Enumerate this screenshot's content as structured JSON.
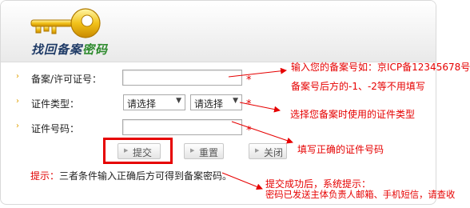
{
  "header": {
    "title_part1": "找回备案",
    "title_part2": "密码"
  },
  "form": {
    "fields": [
      {
        "label": "备案/许可证号：",
        "value": "",
        "required_mark": "*"
      },
      {
        "label": "证件类型：",
        "select1": "请选择",
        "select2": "请选择",
        "required_mark": "*"
      },
      {
        "label": "证件号码：",
        "value": "",
        "required_mark": "*"
      }
    ],
    "buttons": {
      "submit": "提交",
      "reset": "重置",
      "close": "关闭"
    },
    "tip_prefix": "提示：",
    "tip_text": "三者条件输入正确后方可得到备案密码。"
  },
  "annotations": {
    "a1": "输入您的备案号如：京ICP备12345678号",
    "a2": "备案号后方的-1、-2等不用填写",
    "a3": "选择您备案时使用的证件类型",
    "a4": "填写正确的证件号码",
    "a5": "提交成功后，系统提示：",
    "a6": "密码已发送主体负责人邮箱、手机短信，请查收"
  },
  "colors": {
    "annotation": "#e60000",
    "title_dark": "#1e3a66",
    "title_green": "#2e8b2e",
    "bullet": "#e0a000"
  },
  "icons": {
    "header": "key-icon",
    "bullet": "triangle-bullet-icon"
  }
}
